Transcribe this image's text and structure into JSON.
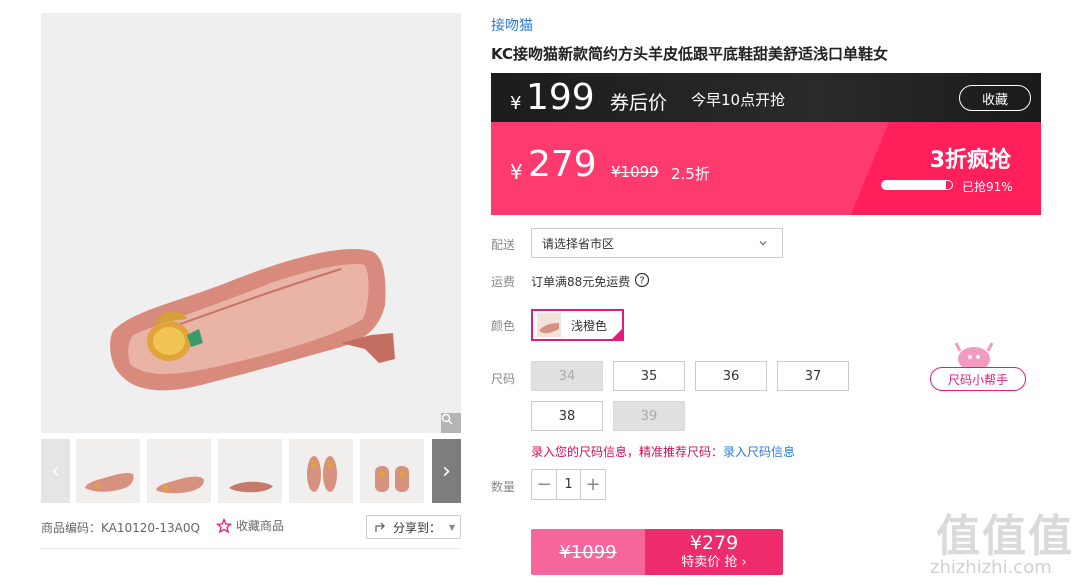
{
  "product": {
    "brand": "接吻猫",
    "title": "KC接吻猫新款简约方头羊皮低跟平底鞋甜美舒适浅口单鞋女",
    "code_label": "商品编码：KA10120-13A0Q",
    "favorite_label": "收藏商品",
    "share_label": "分享到："
  },
  "coupon": {
    "currency": "¥",
    "price": "199",
    "label": "券后价",
    "time": "今早10点开抢",
    "collect_label": "收藏"
  },
  "sale": {
    "currency": "¥",
    "price": "279",
    "original": "¥1099",
    "discount": "2.5折",
    "flash_label": "3折疯抢",
    "sold_percent": 91,
    "sold_label": "已抢91%"
  },
  "delivery": {
    "label": "配送",
    "placeholder": "请选择省市区"
  },
  "shipping": {
    "label": "运费",
    "text": "订单满88元免运费"
  },
  "color": {
    "label": "颜色",
    "selected": "浅橙色"
  },
  "size": {
    "label": "尺码",
    "options": [
      {
        "value": "34",
        "available": false
      },
      {
        "value": "35",
        "available": true
      },
      {
        "value": "36",
        "available": true
      },
      {
        "value": "37",
        "available": true
      },
      {
        "value": "38",
        "available": true
      },
      {
        "value": "39",
        "available": false
      }
    ],
    "helper_label": "尺码小帮手",
    "info_text": "录入您的尺码信息，精准推荐尺码：",
    "info_link": "录入尺码信息"
  },
  "quantity": {
    "label": "数量",
    "value": "1",
    "minus": "−",
    "plus": "+"
  },
  "buy": {
    "original": "¥1099",
    "price": "¥279",
    "label": "特卖价 抢 ›"
  },
  "watermark": {
    "big": "值值值",
    "small": "zhizhizhi.com"
  },
  "colors": {
    "accent": "#e31c79",
    "sale_bg": "#ff3a6e",
    "link": "#2b7bd6"
  }
}
